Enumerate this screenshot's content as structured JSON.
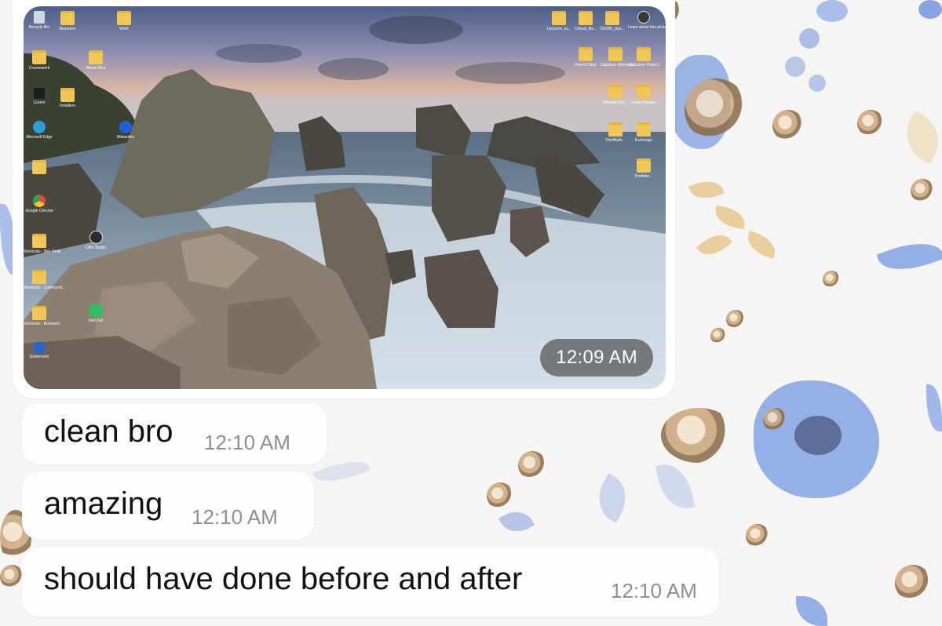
{
  "photo_message": {
    "timestamp": "12:09 AM",
    "desktop_icons": [
      {
        "label": "Recycle Bin",
        "icon": "recycle-bin-icon"
      },
      {
        "label": "Resumes",
        "icon": "folder-icon"
      },
      {
        "label": "Work",
        "icon": "folder-icon"
      },
      {
        "label": "Coursework",
        "icon": "folder-icon"
      },
      {
        "label": "Meow Pics",
        "icon": "folder-icon"
      },
      {
        "label": "Cursor",
        "icon": "cursor-app-icon"
      },
      {
        "label": "Installers",
        "icon": "folder-icon"
      },
      {
        "label": "Microsoft Edge",
        "icon": "edge-icon"
      },
      {
        "label": "Bitwarden",
        "icon": "bitwarden-icon"
      },
      {
        "label": "",
        "icon": "folder-icon"
      },
      {
        "label": "Google Chrome",
        "icon": "chrome-icon"
      },
      {
        "label": "OBS Studio",
        "icon": "obs-icon"
      },
      {
        "label": "Shortcuts - Dev Tools",
        "icon": "folder-icon"
      },
      {
        "label": "Shortcuts - Communic...",
        "icon": "folder-icon"
      },
      {
        "label": "Shortcuts - Browsers",
        "icon": "folder-icon"
      },
      {
        "label": "WeChat",
        "icon": "wechat-icon"
      },
      {
        "label": "Grammarly",
        "icon": "grammarly-icon"
      },
      {
        "label": "Lectures_at...",
        "icon": "folder-icon"
      },
      {
        "label": "Critical_Re...",
        "icon": "folder-icon"
      },
      {
        "label": "ISIOffS_Ass...",
        "icon": "folder-icon"
      },
      {
        "label": "Learn about this picture",
        "icon": "camera-icon"
      },
      {
        "label": "Fintech Mod",
        "icon": "folder-icon"
      },
      {
        "label": "Capstone Writeups",
        "icon": "folder-icon"
      },
      {
        "label": "Capstone Project",
        "icon": "folder-icon"
      },
      {
        "label": "Remote Dev...",
        "icon": "folder-icon"
      },
      {
        "label": "Learn Pandas",
        "icon": "folder-icon"
      },
      {
        "label": "FlexMyAr...",
        "icon": "folder-icon"
      },
      {
        "label": "Exchange",
        "icon": "folder-icon"
      },
      {
        "label": "Portfolio...",
        "icon": "folder-icon"
      }
    ]
  },
  "messages": [
    {
      "text": "clean bro",
      "time": "12:10 AM"
    },
    {
      "text": "amazing",
      "time": "12:10 AM"
    },
    {
      "text": "should have done before and after",
      "time": "12:10 AM"
    }
  ],
  "colors": {
    "bubble": "#fdfdfd",
    "timestamp_text": "#8e8e93",
    "time_pill": "#3c3c3c",
    "wallpaper_blue": "#6c8fd6",
    "wallpaper_gold": "#c9a57a"
  }
}
